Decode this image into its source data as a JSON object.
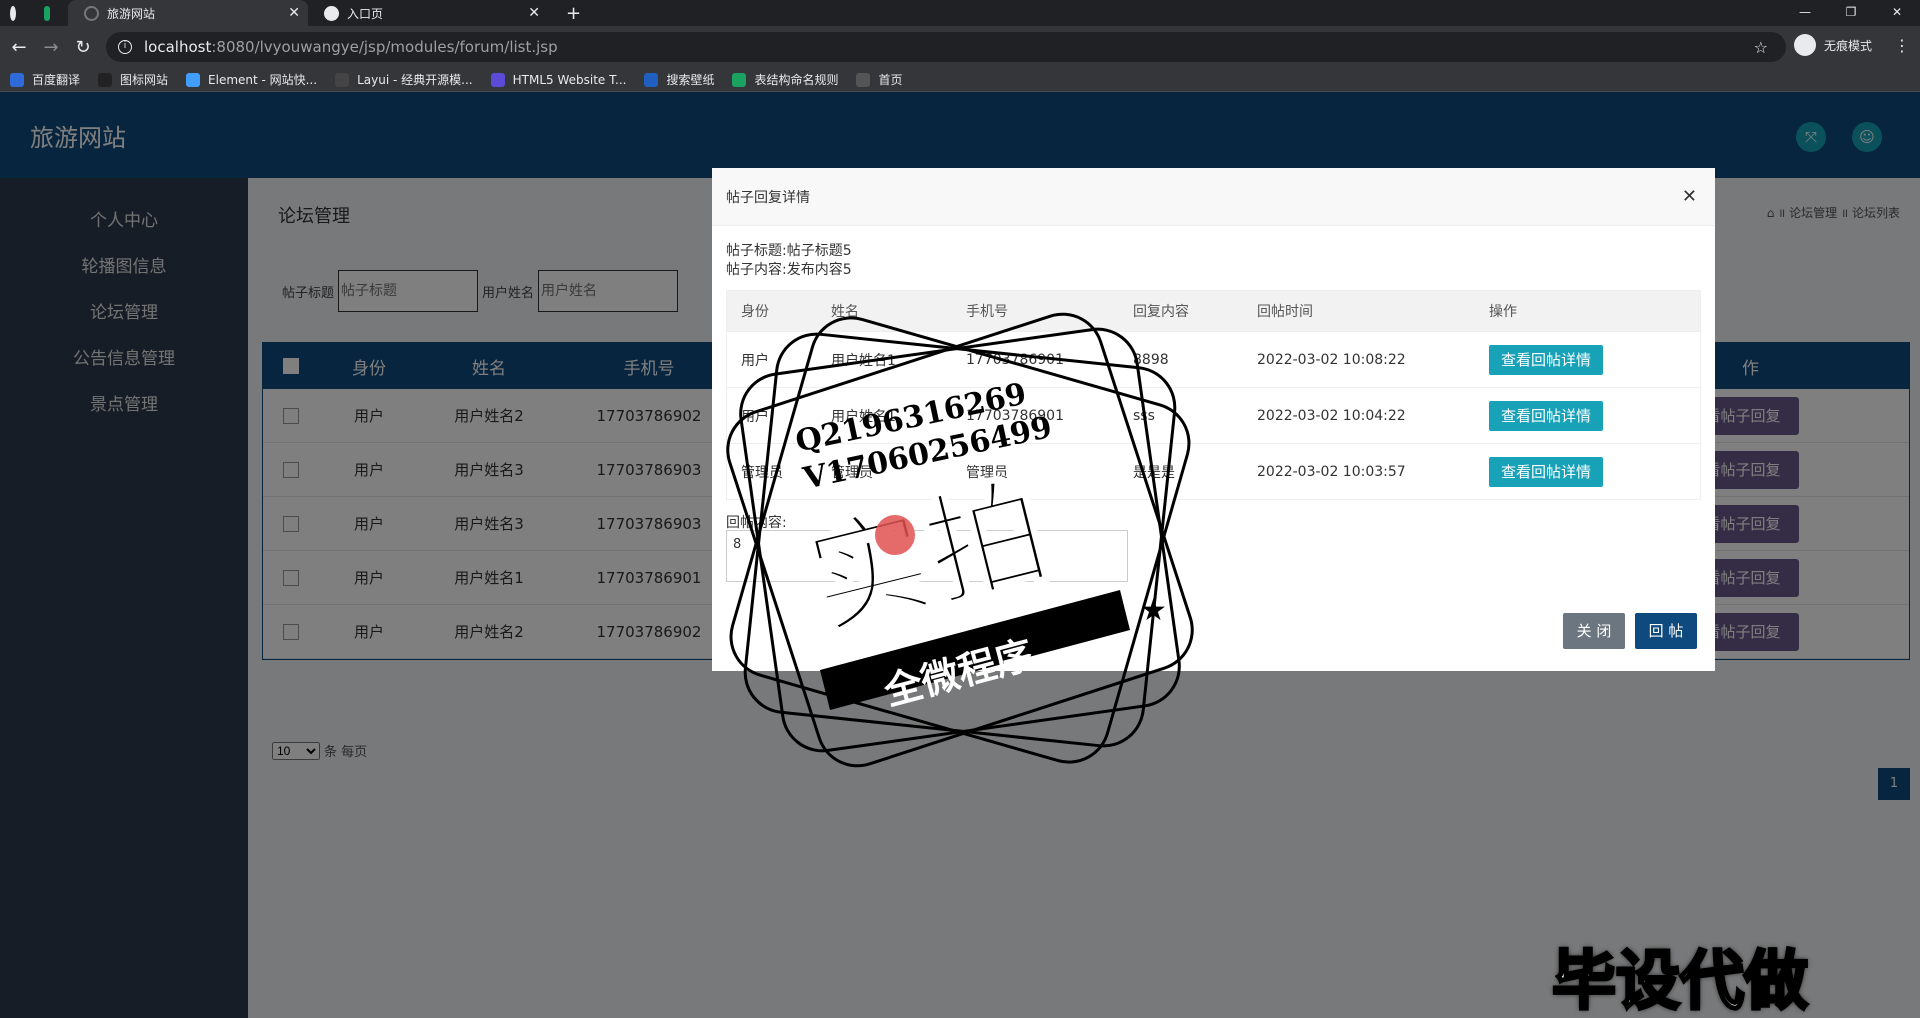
{
  "browser": {
    "tabs": [
      {
        "label": ""
      },
      {
        "label": ""
      },
      {
        "label": "旅游网站"
      },
      {
        "label": "入口页"
      }
    ],
    "url_host": "localhost",
    "url_path": ":8080/lvyouwangye/jsp/modules/forum/list.jsp",
    "incognito_label": "无痕模式",
    "bookmarks": [
      {
        "label": "百度翻译",
        "color": "#2f6bd8"
      },
      {
        "label": "图标网站",
        "color": "#222222"
      },
      {
        "label": "Element - 网站快...",
        "color": "#409eff"
      },
      {
        "label": "Layui - 经典开源模...",
        "color": "#444444"
      },
      {
        "label": "HTML5 Website T...",
        "color": "#5b4bd6"
      },
      {
        "label": "搜索壁纸",
        "color": "#1f5fbf"
      },
      {
        "label": "表结构命名规则",
        "color": "#1aa260"
      },
      {
        "label": "首页",
        "color": "#555555"
      }
    ]
  },
  "app": {
    "brand": "旅游网站",
    "sidebar": [
      "个人中心",
      "轮播图信息",
      "论坛管理",
      "公告信息管理",
      "景点管理"
    ],
    "page_title": "论坛管理",
    "breadcrumb": "⌂ ॥ 论坛管理 ॥ 论坛列表",
    "filter": {
      "title_label": "帖子标题",
      "title_placeholder": "帖子标题",
      "user_label": "用户姓名",
      "user_placeholder": "用户姓名"
    },
    "table": {
      "headers": [
        "身份",
        "姓名",
        "手机号",
        "作"
      ],
      "rows": [
        [
          "用户",
          "用户姓名2",
          "17703786902"
        ],
        [
          "用户",
          "用户姓名3",
          "17703786903"
        ],
        [
          "用户",
          "用户姓名3",
          "17703786903"
        ],
        [
          "用户",
          "用户姓名1",
          "17703786901"
        ],
        [
          "用户",
          "用户姓名2",
          "17703786902"
        ]
      ],
      "row_button": "看帖子回复"
    },
    "pager": {
      "per_page": "10",
      "per_page_suffix": "条 每页",
      "current_page": "1"
    }
  },
  "modal": {
    "title": "帖子回复详情",
    "post_title": "帖子标题:帖子标题5",
    "post_content": "帖子内容:发布内容5",
    "headers": [
      "身份",
      "姓名",
      "手机号",
      "回复内容",
      "回帖时间",
      "操作"
    ],
    "rows": [
      [
        "用户",
        "用户姓名1",
        "17703786901",
        "8898",
        "2022-03-02 10:08:22"
      ],
      [
        "用户",
        "用户姓名1",
        "17703786901",
        "sss",
        "2022-03-02 10:04:22"
      ],
      [
        "管理员",
        "管理员",
        "管理员",
        "是是是",
        "2022-03-02 10:03:57"
      ]
    ],
    "view_button": "查看回帖详情",
    "reply_label": "回帖内容:",
    "reply_value": "8",
    "close_button": "关 闭",
    "reply_button": "回 帖"
  },
  "watermark": {
    "qq": "Q2196316269",
    "vx": "V17060256499",
    "big": "实拍",
    "ribbon": "全微程序",
    "corner": "毕设代做"
  }
}
